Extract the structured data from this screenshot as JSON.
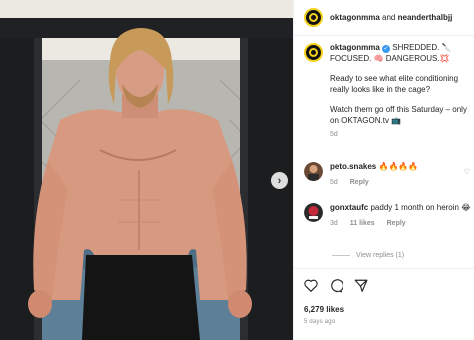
{
  "post": {
    "author": "oktagonmma",
    "connector": "and",
    "coauthor": "neanderthalbjj",
    "caption_line1": "SHREDDED. 🔪",
    "caption_line2": "FOCUSED. 🧠 DANGEROUS.💢",
    "caption_para2": "Ready to see what elite conditioning really looks like in the cage?",
    "caption_para3": "Watch them go off this Saturday – only on OKTAGON.tv 📺",
    "caption_age": "5d",
    "likes": "6,279 likes",
    "posted": "5 days ago"
  },
  "comments": [
    {
      "user": "peto.snakes",
      "text": "🔥🔥🔥🔥",
      "age": "5d",
      "reply": "Reply"
    },
    {
      "user": "gonxtaufc",
      "text": "paddy 1 month on heroin 😂",
      "age": "3d",
      "likes": "11 likes",
      "reply": "Reply",
      "view_replies": "View replies (1)"
    }
  ],
  "icons": {
    "media_next": "chevron-right-icon",
    "verified": "verified-badge-icon",
    "like": "heart-icon",
    "comment": "comment-icon",
    "share": "send-icon"
  },
  "colors": {
    "brand_yellow": "#f5d21d",
    "verified_blue": "#3897f0",
    "muted": "#8e8e8e"
  }
}
